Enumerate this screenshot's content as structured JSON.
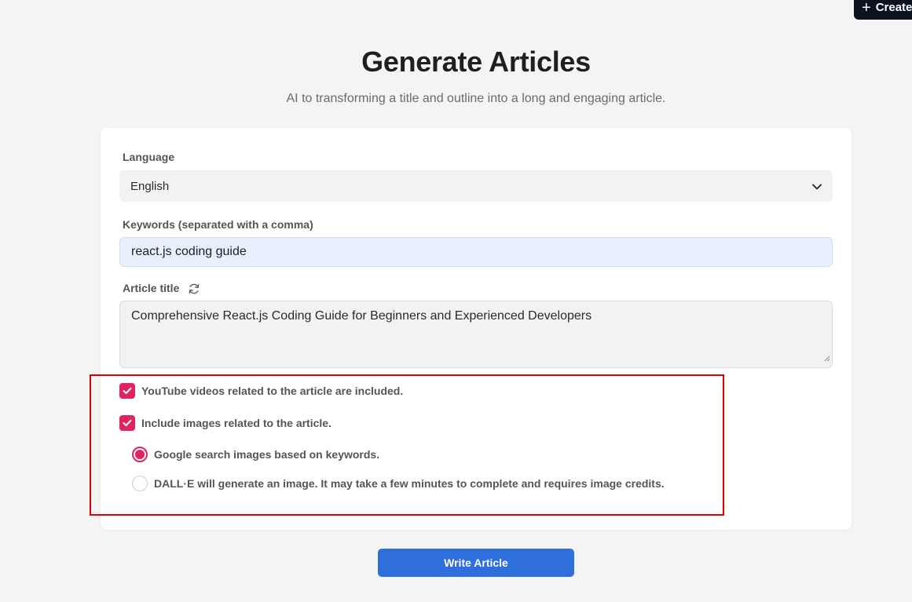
{
  "header": {
    "create_label": "Create",
    "title": "Generate Articles",
    "subtitle": "AI to transforming a title and outline into a long and engaging article."
  },
  "form": {
    "language": {
      "label": "Language",
      "selected": "English"
    },
    "keywords": {
      "label": "Keywords (separated with a comma)",
      "value": "react.js coding guide"
    },
    "article_title": {
      "label": "Article title",
      "value": "Comprehensive React.js Coding Guide for Beginners and Experienced Developers"
    },
    "options": {
      "youtube": {
        "label": "YouTube videos related to the article are included.",
        "checked": true
      },
      "images": {
        "label": "Include images related to the article.",
        "checked": true
      },
      "image_source": {
        "selected": "google",
        "google_label": "Google search images based on keywords.",
        "dalle_label": "DALL·E will generate an image. It may take a few minutes to complete and requires image credits."
      }
    },
    "submit_label": "Write Article"
  },
  "colors": {
    "accent": "#e0245e",
    "primary_button": "#2e6fdb",
    "highlight_border": "#e00000",
    "create_button": "#0b1220"
  }
}
